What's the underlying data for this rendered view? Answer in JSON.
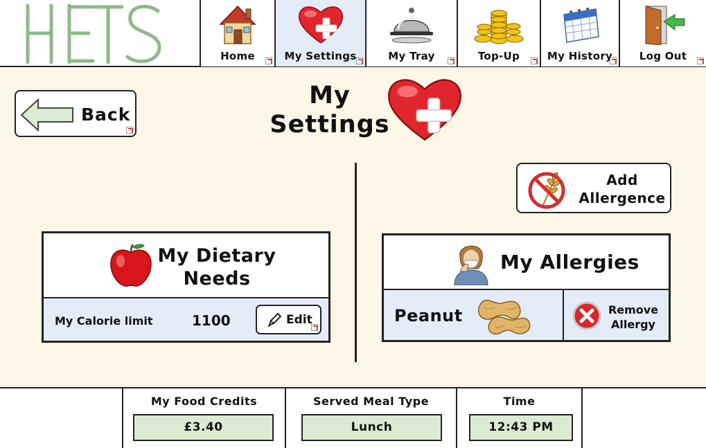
{
  "app": {
    "logo_text": "HETS"
  },
  "nav": {
    "tabs": [
      {
        "label": "Home",
        "icon": "house-icon"
      },
      {
        "label": "My Settings",
        "icon": "heart-plus-icon",
        "active": true
      },
      {
        "label": "My Tray",
        "icon": "food-tray-icon"
      },
      {
        "label": "Top-Up",
        "icon": "coins-icon"
      },
      {
        "label": "My History",
        "icon": "calendar-icon"
      },
      {
        "label": "Log Out",
        "icon": "logout-door-icon"
      }
    ]
  },
  "main": {
    "back_label": "Back",
    "title_line1": "My",
    "title_line2": "Settings",
    "add_allergence_line1": "Add",
    "add_allergence_line2": "Allergence",
    "dietary": {
      "title_line1": "My Dietary",
      "title_line2": "Needs",
      "calorie_label": "My Calorie limit",
      "calorie_value": "1100",
      "edit_label": "Edit"
    },
    "allergies": {
      "title": "My Allergies",
      "items": [
        {
          "name": "Peanut",
          "icon": "peanut-icon"
        }
      ],
      "remove_line1": "Remove",
      "remove_line2": "Allergy"
    }
  },
  "status": {
    "credits_label": "My Food Credits",
    "credits_value": "£3.40",
    "meal_label": "Served Meal Type",
    "meal_value": "Lunch",
    "time_label": "Time",
    "time_value": "12:43 PM"
  },
  "colors": {
    "main_bg": "#fcf7e7",
    "active_tab": "#e4ecf7",
    "row_bg": "#e4ecf7",
    "status_value_bg": "#dcebd3",
    "logo": "#8fb98a",
    "heart_red": "#e0262c",
    "back_arrow_fill": "#dcebd3"
  }
}
